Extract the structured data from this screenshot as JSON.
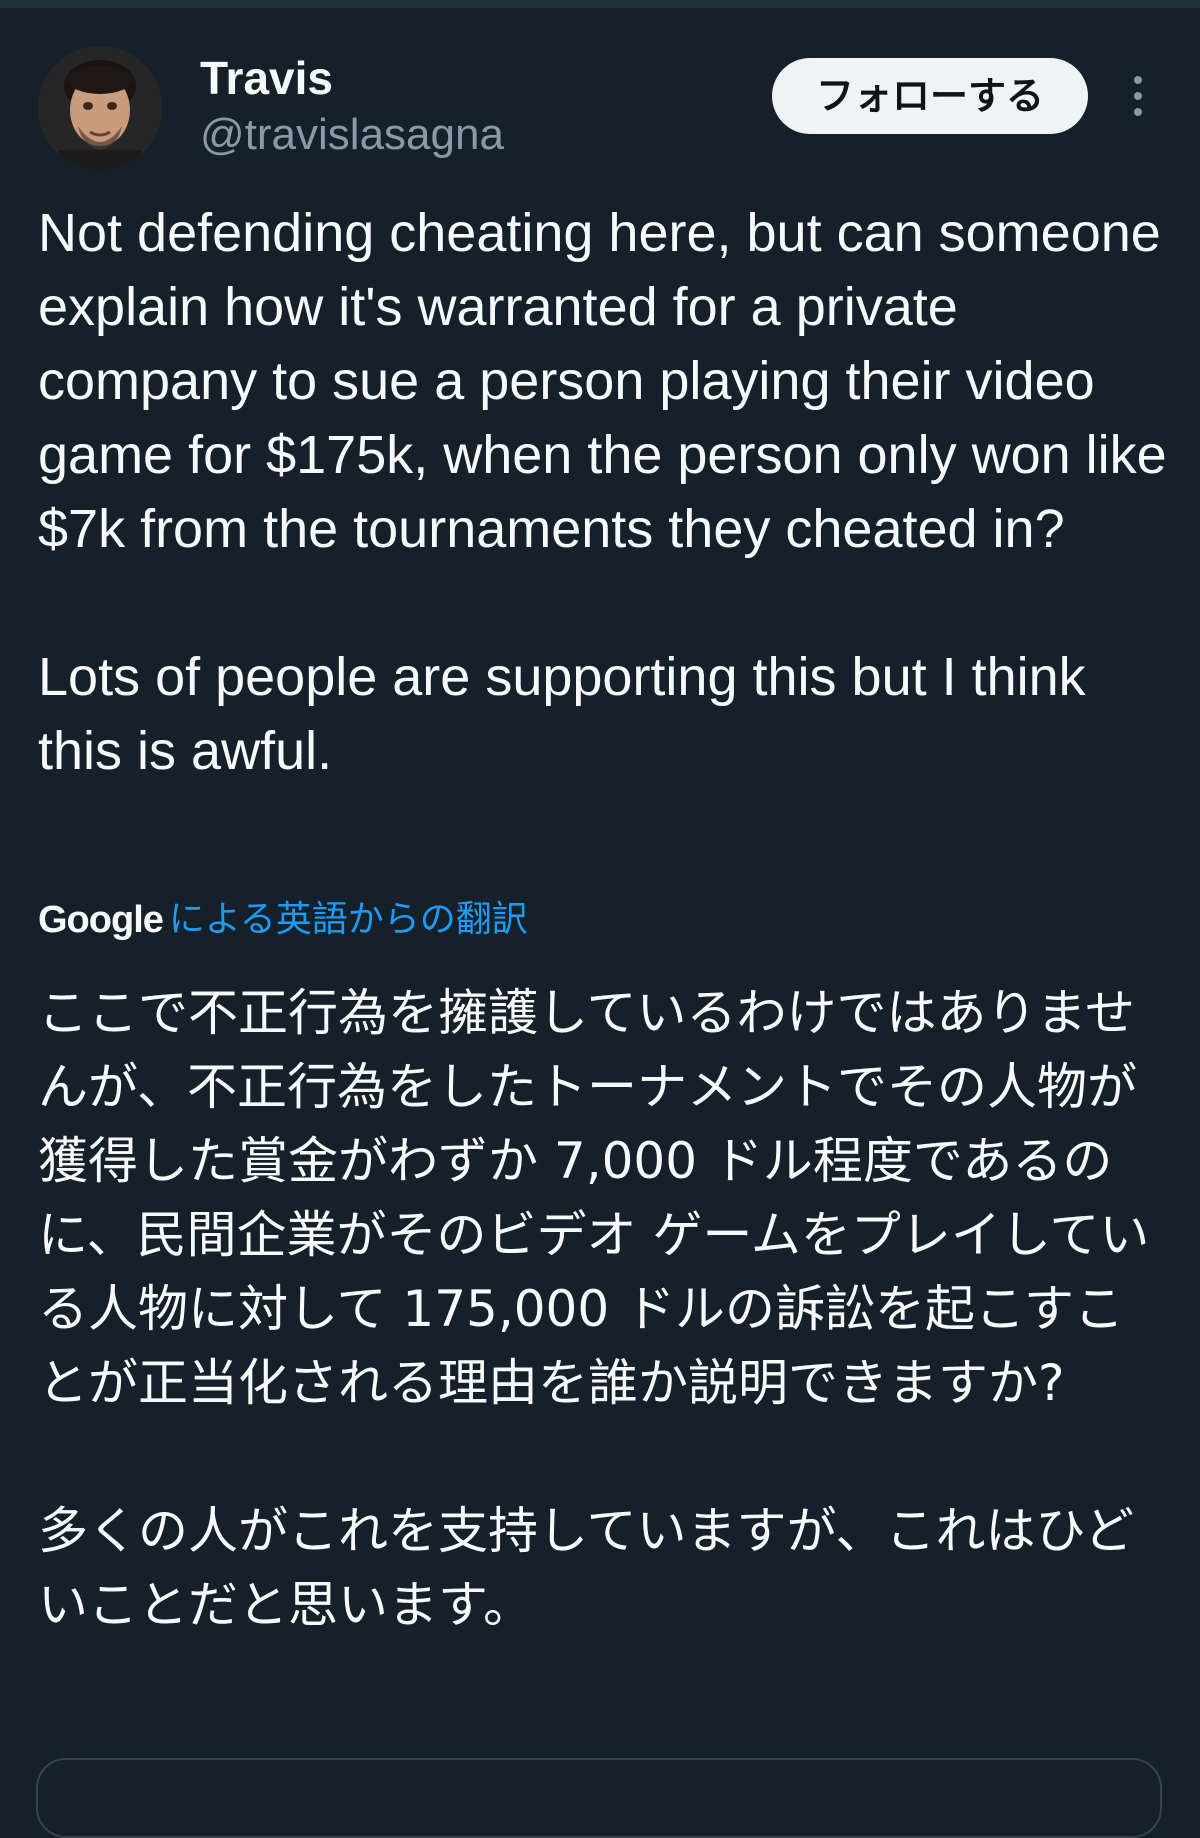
{
  "tweet": {
    "author": {
      "name": "Travis",
      "handle": "@travislasagna"
    },
    "follow_label": "フォローする",
    "more_icon": "more-dots-icon",
    "text_paragraphs": [
      "Not defending cheating here, but can someone explain how it's warranted for a private company to sue a person playing their video game for $175k, when the person only won like $7k from the tournaments they cheated in?",
      "Lots of people are supporting this but I think this is awful."
    ],
    "translation": {
      "provider": "Google",
      "label": "による英語からの翻訳",
      "paragraphs": [
        "ここで不正行為を擁護しているわけではありませんが、不正行為をしたトーナメントでその人物が獲得した賞金がわずか 7,000 ドル程度であるのに、民間企業がそのビデオ ゲームをプレイしている人物に対して 175,000 ドルの訴訟を起こすことが正当化される理由を誰か説明できますか?",
        "多くの人がこれを支持していますが、これはひどいことだと思います。"
      ]
    }
  },
  "colors": {
    "background": "#15202b",
    "text": "#f7f9f9",
    "secondary_text": "#8b98a5",
    "link": "#1d9bf0",
    "follow_button_bg": "#eff3f4"
  }
}
